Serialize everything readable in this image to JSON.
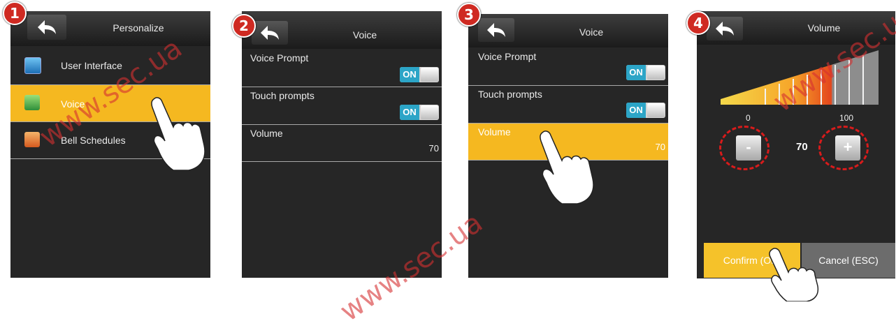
{
  "steps": [
    {
      "number": "1",
      "title": "Personalize",
      "items": [
        {
          "label": "User Interface",
          "icon": "monitor-icon"
        },
        {
          "label": "Voice",
          "icon": "speaker-icon"
        },
        {
          "label": "Bell Schedules",
          "icon": "bell-icon"
        }
      ]
    },
    {
      "number": "2",
      "title": "Voice",
      "voice_prompt": "Voice Prompt",
      "voice_prompt_state": "ON",
      "touch_prompts": "Touch prompts",
      "touch_prompts_state": "ON",
      "volume": "Volume",
      "volume_value": "70"
    },
    {
      "number": "3",
      "title": "Voice",
      "voice_prompt": "Voice Prompt",
      "voice_prompt_state": "ON",
      "touch_prompts": "Touch prompts",
      "touch_prompts_state": "ON",
      "volume": "Volume",
      "volume_value": "70"
    },
    {
      "number": "4",
      "title": "Volume",
      "min": "0",
      "max": "100",
      "value": "70",
      "level": 0.7,
      "minus": "-",
      "plus": "+",
      "confirm": "Confirm (OK)",
      "cancel": "Cancel (ESC)"
    }
  ],
  "watermark": "www.sec.ua",
  "colors": {
    "accent": "#f5b820",
    "toggle_on": "#2ca5c7",
    "badge": "#cf2a22",
    "background": "#262626"
  }
}
